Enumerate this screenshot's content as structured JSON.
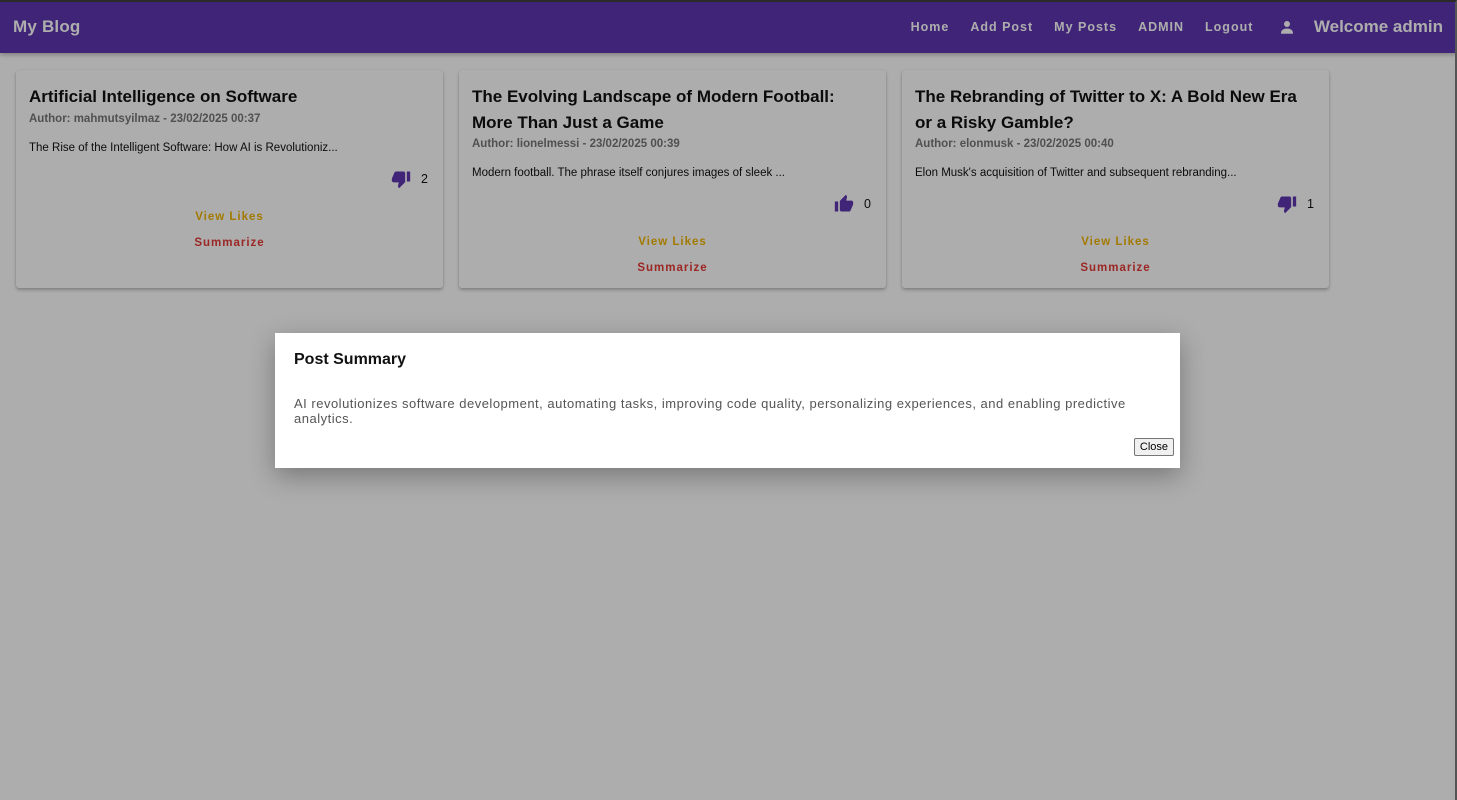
{
  "header": {
    "brand": "My Blog",
    "nav": [
      "Home",
      "Add Post",
      "My Posts",
      "ADMIN",
      "Logout"
    ],
    "account_icon": "person-icon",
    "welcome": "Welcome admin"
  },
  "posts": [
    {
      "title": "Artificial Intelligence on Software",
      "meta": "Author: mahmutsyilmaz - 23/02/2025 00:37",
      "excerpt": "The Rise of the Intelligent Software: How AI is Revolutioniz...",
      "vote_icon": "thumb-down-icon",
      "count": "2",
      "view_likes": "View Likes",
      "summarize": "Summarize"
    },
    {
      "title": "The Evolving Landscape of Modern Football: More Than Just a Game",
      "meta": "Author: lionelmessi - 23/02/2025 00:39",
      "excerpt": "Modern football. The phrase itself conjures images of sleek ...",
      "vote_icon": "thumb-up-icon",
      "count": "0",
      "view_likes": "View Likes",
      "summarize": "Summarize"
    },
    {
      "title": "The Rebranding of Twitter to X: A Bold New Era or a Risky Gamble?",
      "meta": "Author: elonmusk - 23/02/2025 00:40",
      "excerpt": "Elon Musk's acquisition of Twitter and subsequent rebranding...",
      "vote_icon": "thumb-down-icon",
      "count": "1",
      "view_likes": "View Likes",
      "summarize": "Summarize"
    }
  ],
  "dialog": {
    "title": "Post Summary",
    "body": "AI revolutionizes software development, automating tasks, improving code quality, personalizing experiences, and enabling predictive analytics.",
    "close_label": "Close"
  },
  "colors": {
    "primary": "#5e35b1",
    "view_likes": "#f0b400",
    "summarize": "#e53935"
  }
}
